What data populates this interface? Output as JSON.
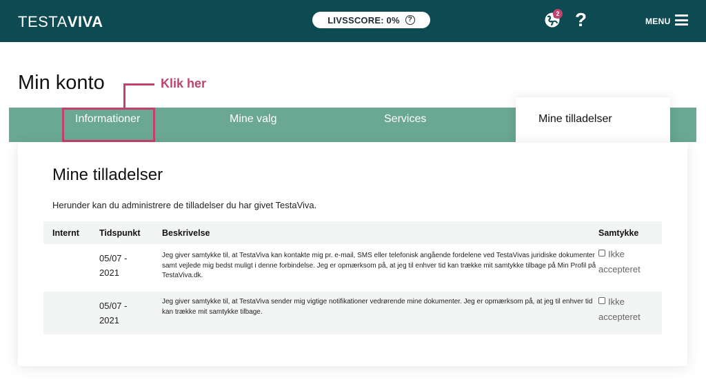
{
  "header": {
    "logo_part1": "TESTA",
    "logo_part2": "VIVA",
    "score_label": "LIVSSCORE: 0%",
    "score_help_icon": "question-circle-icon",
    "notification_count": "2",
    "help_symbol": "?",
    "menu_label": "MENU",
    "colors": {
      "bar": "#0e4a52",
      "badge": "#c2416e"
    }
  },
  "page": {
    "title": "Min konto"
  },
  "annotation": {
    "label": "Klik her",
    "color": "#c2416e"
  },
  "tabs": [
    {
      "label": "Informationer"
    },
    {
      "label": "Mine valg"
    },
    {
      "label": "Services"
    },
    {
      "label": "Mine tilladelser",
      "active": true
    }
  ],
  "content": {
    "title": "Mine tilladelser",
    "intro": "Herunder kan du administrere de tilladelser du har givet TestaViva.",
    "columns": [
      "Internt",
      "Tidspunkt",
      "Beskrivelse",
      "Samtykke"
    ],
    "rows": [
      {
        "internt": "",
        "date_line1": "05/07 -",
        "date_line2": "2021",
        "description": "Jeg giver samtykke til, at TestaViva kan kontakte mig pr. e-mail, SMS eller telefonisk angående fordelene ved TestaVivas juridiske dokumenter samt vejlede mig bedst muligt i denne forbindelse. Jeg er opmærksom på, at jeg til enhver tid kan trække mit samtykke tilbage på Min Profil på TestaViva.dk.",
        "consent_line1": "Ikke",
        "consent_line2": "accepteret"
      },
      {
        "internt": "",
        "date_line1": "05/07 -",
        "date_line2": "2021",
        "description": "Jeg giver samtykke til, at TestaViva sender mig vigtige notifikationer vedrørende mine dokumenter. Jeg er opmærksom på, at jeg til enhver tid kan trække mit samtykke tilbage.",
        "consent_line1": "Ikke",
        "consent_line2": "accepteret"
      }
    ]
  },
  "colors": {
    "tab_bar": "#6aa893"
  }
}
